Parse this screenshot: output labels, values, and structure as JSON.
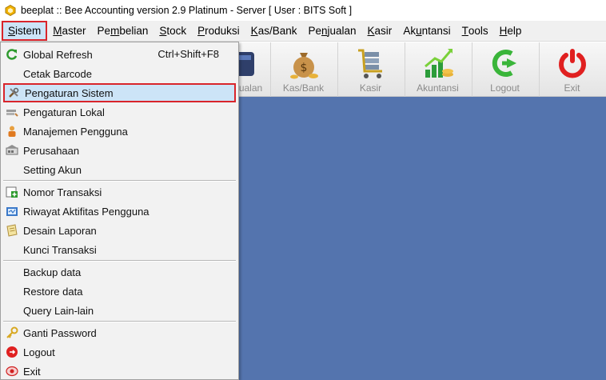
{
  "window": {
    "title": "beeplat :: Bee Accounting version 2.9 Platinum - Server  [ User : BITS Soft ]"
  },
  "menubar": {
    "items": [
      {
        "pre": "",
        "ul": "S",
        "post": "istem"
      },
      {
        "pre": "",
        "ul": "M",
        "post": "aster"
      },
      {
        "pre": "Pe",
        "ul": "m",
        "post": "belian"
      },
      {
        "pre": "",
        "ul": "S",
        "post": "tock"
      },
      {
        "pre": "",
        "ul": "P",
        "post": "roduksi"
      },
      {
        "pre": "",
        "ul": "K",
        "post": "as/Bank"
      },
      {
        "pre": "Pe",
        "ul": "n",
        "post": "jualan"
      },
      {
        "pre": "",
        "ul": "K",
        "post": "asir"
      },
      {
        "pre": "Ak",
        "ul": "u",
        "post": "ntansi"
      },
      {
        "pre": "",
        "ul": "T",
        "post": "ools"
      },
      {
        "pre": "",
        "ul": "H",
        "post": "elp"
      }
    ]
  },
  "toolbar": {
    "items": [
      {
        "label": "Penjualan"
      },
      {
        "label": "Kas/Bank"
      },
      {
        "label": "Kasir"
      },
      {
        "label": "Akuntansi"
      },
      {
        "label": "Logout"
      },
      {
        "label": "Exit"
      }
    ]
  },
  "dropdown": {
    "items": [
      {
        "label": "Global Refresh",
        "shortcut": "Ctrl+Shift+F8",
        "icon": "refresh-icon"
      },
      {
        "label": "Cetak Barcode",
        "icon": ""
      },
      {
        "label": "Pengaturan Sistem",
        "icon": "tools-icon"
      },
      {
        "label": "Pengaturan Lokal",
        "icon": "local-settings-icon"
      },
      {
        "label": "Manajemen Pengguna",
        "icon": "user-icon"
      },
      {
        "label": "Perusahaan",
        "icon": "company-icon"
      },
      {
        "label": "Setting Akun",
        "icon": ""
      },
      {
        "label": "Nomor Transaksi",
        "icon": "add-number-icon"
      },
      {
        "label": "Riwayat Aktifitas Pengguna",
        "icon": "history-icon"
      },
      {
        "label": "Desain Laporan",
        "icon": "report-design-icon"
      },
      {
        "label": "Kunci Transaksi",
        "icon": ""
      },
      {
        "label": "Backup data",
        "icon": ""
      },
      {
        "label": "Restore data",
        "icon": ""
      },
      {
        "label": "Query Lain-lain",
        "icon": ""
      },
      {
        "label": "Ganti Password",
        "icon": "key-icon"
      },
      {
        "label": "Logout",
        "icon": "logout-icon"
      },
      {
        "label": "Exit",
        "icon": "exit-icon"
      }
    ]
  },
  "colors": {
    "desktop": "#5474ae",
    "highlight": "#cce4f7",
    "annotation_red": "#d9252b"
  }
}
